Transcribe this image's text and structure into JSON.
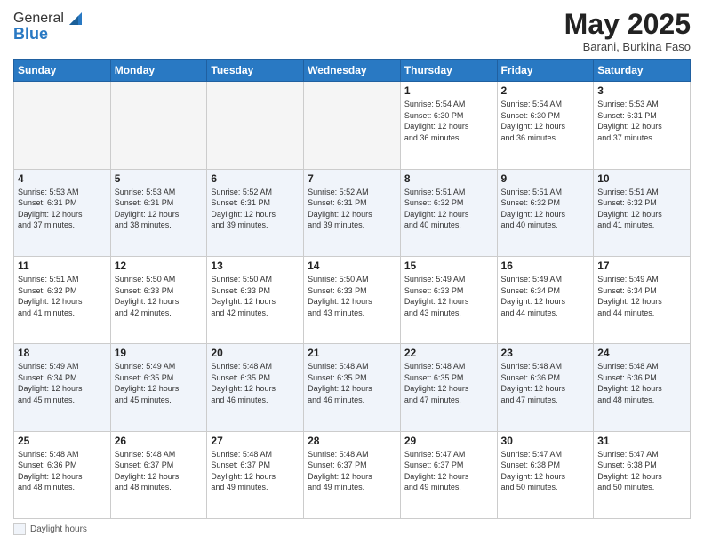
{
  "header": {
    "logo_line1": "General",
    "logo_line2": "Blue",
    "month": "May 2025",
    "location": "Barani, Burkina Faso"
  },
  "weekdays": [
    "Sunday",
    "Monday",
    "Tuesday",
    "Wednesday",
    "Thursday",
    "Friday",
    "Saturday"
  ],
  "weeks": [
    [
      {
        "day": "",
        "info": ""
      },
      {
        "day": "",
        "info": ""
      },
      {
        "day": "",
        "info": ""
      },
      {
        "day": "",
        "info": ""
      },
      {
        "day": "1",
        "info": "Sunrise: 5:54 AM\nSunset: 6:30 PM\nDaylight: 12 hours\nand 36 minutes."
      },
      {
        "day": "2",
        "info": "Sunrise: 5:54 AM\nSunset: 6:30 PM\nDaylight: 12 hours\nand 36 minutes."
      },
      {
        "day": "3",
        "info": "Sunrise: 5:53 AM\nSunset: 6:31 PM\nDaylight: 12 hours\nand 37 minutes."
      }
    ],
    [
      {
        "day": "4",
        "info": "Sunrise: 5:53 AM\nSunset: 6:31 PM\nDaylight: 12 hours\nand 37 minutes."
      },
      {
        "day": "5",
        "info": "Sunrise: 5:53 AM\nSunset: 6:31 PM\nDaylight: 12 hours\nand 38 minutes."
      },
      {
        "day": "6",
        "info": "Sunrise: 5:52 AM\nSunset: 6:31 PM\nDaylight: 12 hours\nand 39 minutes."
      },
      {
        "day": "7",
        "info": "Sunrise: 5:52 AM\nSunset: 6:31 PM\nDaylight: 12 hours\nand 39 minutes."
      },
      {
        "day": "8",
        "info": "Sunrise: 5:51 AM\nSunset: 6:32 PM\nDaylight: 12 hours\nand 40 minutes."
      },
      {
        "day": "9",
        "info": "Sunrise: 5:51 AM\nSunset: 6:32 PM\nDaylight: 12 hours\nand 40 minutes."
      },
      {
        "day": "10",
        "info": "Sunrise: 5:51 AM\nSunset: 6:32 PM\nDaylight: 12 hours\nand 41 minutes."
      }
    ],
    [
      {
        "day": "11",
        "info": "Sunrise: 5:51 AM\nSunset: 6:32 PM\nDaylight: 12 hours\nand 41 minutes."
      },
      {
        "day": "12",
        "info": "Sunrise: 5:50 AM\nSunset: 6:33 PM\nDaylight: 12 hours\nand 42 minutes."
      },
      {
        "day": "13",
        "info": "Sunrise: 5:50 AM\nSunset: 6:33 PM\nDaylight: 12 hours\nand 42 minutes."
      },
      {
        "day": "14",
        "info": "Sunrise: 5:50 AM\nSunset: 6:33 PM\nDaylight: 12 hours\nand 43 minutes."
      },
      {
        "day": "15",
        "info": "Sunrise: 5:49 AM\nSunset: 6:33 PM\nDaylight: 12 hours\nand 43 minutes."
      },
      {
        "day": "16",
        "info": "Sunrise: 5:49 AM\nSunset: 6:34 PM\nDaylight: 12 hours\nand 44 minutes."
      },
      {
        "day": "17",
        "info": "Sunrise: 5:49 AM\nSunset: 6:34 PM\nDaylight: 12 hours\nand 44 minutes."
      }
    ],
    [
      {
        "day": "18",
        "info": "Sunrise: 5:49 AM\nSunset: 6:34 PM\nDaylight: 12 hours\nand 45 minutes."
      },
      {
        "day": "19",
        "info": "Sunrise: 5:49 AM\nSunset: 6:35 PM\nDaylight: 12 hours\nand 45 minutes."
      },
      {
        "day": "20",
        "info": "Sunrise: 5:48 AM\nSunset: 6:35 PM\nDaylight: 12 hours\nand 46 minutes."
      },
      {
        "day": "21",
        "info": "Sunrise: 5:48 AM\nSunset: 6:35 PM\nDaylight: 12 hours\nand 46 minutes."
      },
      {
        "day": "22",
        "info": "Sunrise: 5:48 AM\nSunset: 6:35 PM\nDaylight: 12 hours\nand 47 minutes."
      },
      {
        "day": "23",
        "info": "Sunrise: 5:48 AM\nSunset: 6:36 PM\nDaylight: 12 hours\nand 47 minutes."
      },
      {
        "day": "24",
        "info": "Sunrise: 5:48 AM\nSunset: 6:36 PM\nDaylight: 12 hours\nand 48 minutes."
      }
    ],
    [
      {
        "day": "25",
        "info": "Sunrise: 5:48 AM\nSunset: 6:36 PM\nDaylight: 12 hours\nand 48 minutes."
      },
      {
        "day": "26",
        "info": "Sunrise: 5:48 AM\nSunset: 6:37 PM\nDaylight: 12 hours\nand 48 minutes."
      },
      {
        "day": "27",
        "info": "Sunrise: 5:48 AM\nSunset: 6:37 PM\nDaylight: 12 hours\nand 49 minutes."
      },
      {
        "day": "28",
        "info": "Sunrise: 5:48 AM\nSunset: 6:37 PM\nDaylight: 12 hours\nand 49 minutes."
      },
      {
        "day": "29",
        "info": "Sunrise: 5:47 AM\nSunset: 6:37 PM\nDaylight: 12 hours\nand 49 minutes."
      },
      {
        "day": "30",
        "info": "Sunrise: 5:47 AM\nSunset: 6:38 PM\nDaylight: 12 hours\nand 50 minutes."
      },
      {
        "day": "31",
        "info": "Sunrise: 5:47 AM\nSunset: 6:38 PM\nDaylight: 12 hours\nand 50 minutes."
      }
    ]
  ],
  "footer": {
    "daylight_label": "Daylight hours"
  }
}
